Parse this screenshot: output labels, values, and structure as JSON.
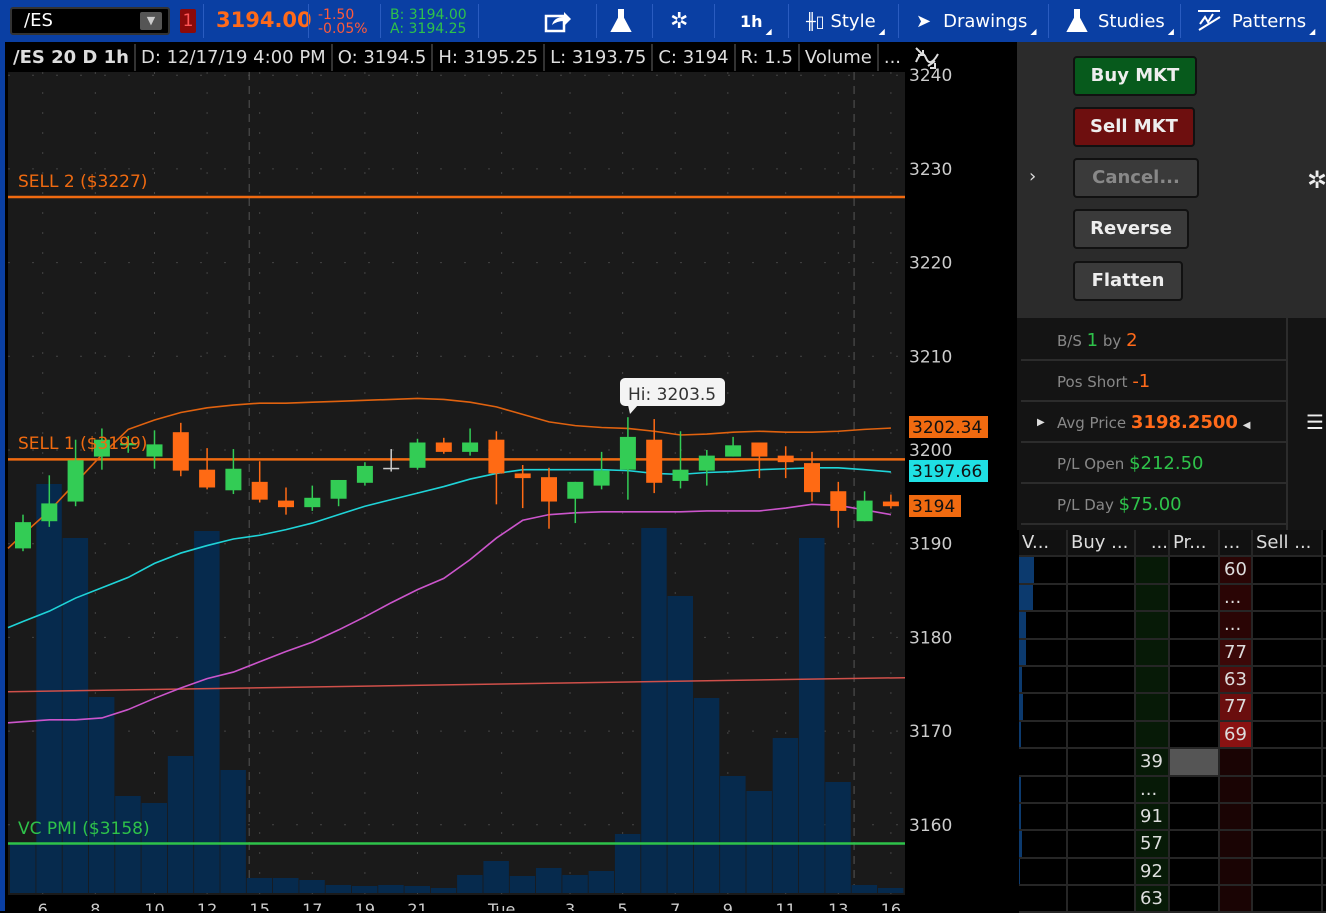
{
  "toolbar": {
    "symbol": "/ES",
    "link_number": "1",
    "last_price": "3194.00",
    "net_change": "-1.50",
    "pct_change": "-0.05%",
    "bid": "B: 3194.00",
    "ask": "A: 3194.25",
    "timeframe": "1h",
    "style": "Style",
    "drawings": "Drawings",
    "studies": "Studies",
    "patterns": "Patterns"
  },
  "info_bar": {
    "title": "/ES 20 D 1h",
    "date": "D: 12/17/19 4:00 PM",
    "open": "O: 3194.5",
    "high": "H: 3195.25",
    "low": "L: 3193.75",
    "close": "C: 3194",
    "range": "R: 1.5",
    "study": "Volume",
    "more": "..."
  },
  "annotations": {
    "sell2": "SELL 2 ($3227)",
    "sell1": "SELL 1 ($3199)",
    "vcpmi": "VC PMI ($3158)",
    "hi_bubble": "Hi: 3203.5"
  },
  "price_badges": {
    "upper": "3202.34",
    "mid": "3197.66",
    "last": "3194"
  },
  "colors": {
    "up": "#33cc55",
    "down": "#ff6a14",
    "volume": "#062a4d",
    "upper_band": "#e0620f",
    "mid_band": "#1fd4d8",
    "lower_band": "#cc55cc",
    "long_line": "#d0504a",
    "sell_line": "#f06a10",
    "pmi_line": "#2ec24a",
    "toolbar": "#0a3fa3"
  },
  "chart_data": {
    "type": "candlestick",
    "title": "/ES 20 D 1h",
    "ylim": [
      3156,
      3242
    ],
    "yticks": [
      "3240",
      "3230",
      "3220",
      "3210",
      "3200",
      "3190",
      "3180",
      "3170",
      "3160"
    ],
    "ytick_values": [
      3240,
      3230,
      3220,
      3210,
      3200,
      3190,
      3180,
      3170,
      3160
    ],
    "xlabels": [
      "6",
      "8",
      "10",
      "12",
      "15",
      "17",
      "19",
      "21",
      "Tue",
      "3",
      "5",
      "7",
      "9",
      "11",
      "13",
      "16"
    ],
    "xlabel_index": [
      0.75,
      2.75,
      5,
      7,
      9,
      11,
      13,
      15,
      18.2,
      20.8,
      22.8,
      24.8,
      26.8,
      29,
      31,
      33
    ],
    "day_breaks": [
      8.6,
      31.6
    ],
    "candles": [
      [
        3189.5,
        3193.1,
        3189.2,
        3192.3
      ],
      [
        3192.4,
        3197.3,
        3191.8,
        3194.3
      ],
      [
        3194.5,
        3201.1,
        3194.0,
        3198.9
      ],
      [
        3199.3,
        3202.3,
        3197.9,
        3201.1
      ],
      [
        3200.5,
        3201.5,
        3199.7,
        3200.75
      ],
      [
        3199.3,
        3202.1,
        3198.0,
        3200.6
      ],
      [
        3201.9,
        3202.9,
        3197.2,
        3197.8
      ],
      [
        3197.9,
        3200.2,
        3195.8,
        3196.0
      ],
      [
        3195.7,
        3200.1,
        3195.3,
        3198.0
      ],
      [
        3196.6,
        3198.8,
        3194.4,
        3194.7
      ],
      [
        3194.6,
        3196.0,
        3193.1,
        3193.9
      ],
      [
        3193.9,
        3196.2,
        3193.5,
        3194.9
      ],
      [
        3194.8,
        3196.8,
        3194.0,
        3196.8
      ],
      [
        3196.5,
        3198.7,
        3196.2,
        3198.3
      ],
      [
        3198.1,
        3200.1,
        3197.7,
        3198.1
      ],
      [
        3198.1,
        3201.2,
        3197.9,
        3200.8
      ],
      [
        3200.8,
        3201.3,
        3199.6,
        3199.8
      ],
      [
        3199.8,
        3202.3,
        3199.4,
        3200.8
      ],
      [
        3201.1,
        3202.0,
        3194.2,
        3197.5
      ],
      [
        3197.5,
        3198.4,
        3193.8,
        3197.0
      ],
      [
        3197.1,
        3198.1,
        3191.6,
        3194.5
      ],
      [
        3194.8,
        3196.6,
        3192.2,
        3196.6
      ],
      [
        3196.2,
        3199.8,
        3195.8,
        3197.8
      ],
      [
        3197.9,
        3203.5,
        3194.7,
        3201.4
      ],
      [
        3201.1,
        3203.3,
        3195.4,
        3196.5
      ],
      [
        3196.7,
        3202.0,
        3195.9,
        3197.9
      ],
      [
        3197.8,
        3200.0,
        3196.2,
        3199.4
      ],
      [
        3199.3,
        3201.4,
        3199.3,
        3200.5
      ],
      [
        3200.8,
        3200.8,
        3197.0,
        3199.3
      ],
      [
        3199.4,
        3200.4,
        3197.0,
        3198.7
      ],
      [
        3198.6,
        3199.8,
        3194.5,
        3195.5
      ],
      [
        3195.6,
        3196.6,
        3191.7,
        3193.5
      ],
      [
        3192.4,
        3195.6,
        3192.4,
        3194.6
      ],
      [
        3194.5,
        3195.25,
        3193.75,
        3194.0
      ]
    ],
    "volume_relative": [
      50,
      409,
      355,
      196,
      97,
      90,
      137,
      362,
      123,
      15,
      15,
      13,
      8,
      7,
      8,
      7,
      5,
      18,
      32,
      17,
      25,
      18,
      22,
      59,
      365,
      297,
      195,
      117,
      102,
      155,
      355,
      111,
      8,
      5
    ],
    "upper_band": [
      3191.0,
      3193.5,
      3196.5,
      3199.5,
      3202.2,
      3203.2,
      3204.0,
      3204.5,
      3204.8,
      3205.0,
      3205.0,
      3205.1,
      3205.2,
      3205.3,
      3205.4,
      3205.5,
      3205.4,
      3205.1,
      3204.6,
      3203.8,
      3203.0,
      3202.6,
      3202.4,
      3202.3,
      3202.0,
      3201.6,
      3201.7,
      3201.9,
      3202.0,
      3201.9,
      3201.9,
      3202.0,
      3202.2,
      3202.34
    ],
    "mid_band": [
      3181.7,
      3182.8,
      3184.2,
      3185.3,
      3186.4,
      3187.9,
      3189.0,
      3189.8,
      3190.5,
      3190.9,
      3191.5,
      3192.2,
      3193.1,
      3194.0,
      3194.7,
      3195.4,
      3196.1,
      3196.9,
      3197.5,
      3197.9,
      3197.9,
      3197.9,
      3197.9,
      3197.8,
      3197.5,
      3197.4,
      3197.6,
      3197.7,
      3197.9,
      3198.0,
      3198.1,
      3198.1,
      3197.9,
      3197.66
    ],
    "lower_band": [
      3171.0,
      3171.2,
      3171.2,
      3171.4,
      3172.3,
      3173.5,
      3174.6,
      3175.6,
      3176.3,
      3177.4,
      3178.5,
      3179.5,
      3180.8,
      3182.2,
      3183.7,
      3185.1,
      3186.3,
      3188.3,
      3190.6,
      3192.5,
      3193.1,
      3193.3,
      3193.4,
      3193.4,
      3193.4,
      3193.4,
      3193.5,
      3193.5,
      3193.5,
      3193.8,
      3194.2,
      3194.1,
      3193.6,
      3193.1
    ],
    "long_line": [
      3174.2,
      3175.7
    ],
    "levels": [
      {
        "name": "SELL 2",
        "value": 3227
      },
      {
        "name": "SELL 1",
        "value": 3199
      },
      {
        "name": "VC PMI",
        "value": 3158
      }
    ]
  },
  "order_panel": {
    "buy": "Buy MKT",
    "sell": "Sell MKT",
    "cancel": "Cancel...",
    "reverse": "Reverse",
    "flatten": "Flatten"
  },
  "position": {
    "bs_label": "B/S",
    "bs_qty": "1",
    "bs_by": "by",
    "bs_tick": "2",
    "pos_label": "Pos Short",
    "pos_val": "-1",
    "avg_label": "Avg Price",
    "avg_val": "3198.2500",
    "plo_label": "P/L Open",
    "plo_val": "$212.50",
    "pld_label": "P/L Day",
    "pld_val": "$75.00"
  },
  "ladder": {
    "headers": [
      "V...",
      "Buy ...",
      "...",
      "Pr...",
      "...",
      "Sell ..."
    ],
    "rows": [
      {
        "vol": 0.3,
        "bid": "",
        "ask": "60",
        "askshade": 1
      },
      {
        "vol": 0.28,
        "bid": "",
        "ask": "...",
        "askshade": 1
      },
      {
        "vol": 0.15,
        "bid": "",
        "ask": "...",
        "askshade": 1
      },
      {
        "vol": 0.15,
        "bid": "",
        "ask": "77",
        "askshade": 2
      },
      {
        "vol": 0.07,
        "bid": "",
        "ask": "63",
        "askshade": 3
      },
      {
        "vol": 0.09,
        "bid": "",
        "ask": "77",
        "askshade": 4
      },
      {
        "vol": 0.04,
        "bid": "",
        "ask": "69",
        "askshade": 5
      },
      {
        "vol": 0,
        "bid": "39",
        "ask": "",
        "askshade": 0,
        "current": true
      },
      {
        "vol": 0.04,
        "bid": "...",
        "ask": "",
        "askshade": 0
      },
      {
        "vol": 0.05,
        "bid": "91",
        "ask": "",
        "askshade": 0
      },
      {
        "vol": 0.06,
        "bid": "57",
        "ask": "",
        "askshade": 0
      },
      {
        "vol": 0.02,
        "bid": "92",
        "ask": "",
        "askshade": 0
      },
      {
        "vol": 0,
        "bid": "63",
        "ask": "",
        "askshade": 0
      }
    ]
  }
}
